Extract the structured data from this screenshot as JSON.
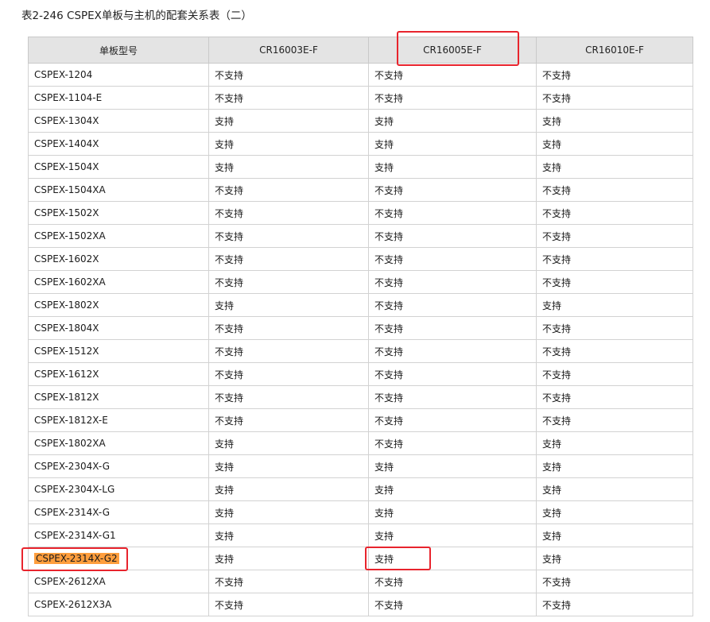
{
  "table": {
    "caption": "表2-246 CSPEX单板与主机的配套关系表（二）",
    "headers": [
      "单板型号",
      "CR16003E-F",
      "CR16005E-F",
      "CR16010E-F"
    ],
    "rows": [
      [
        "CSPEX-1204",
        "不支持",
        "不支持",
        "不支持"
      ],
      [
        "CSPEX-1104-E",
        "不支持",
        "不支持",
        "不支持"
      ],
      [
        "CSPEX-1304X",
        "支持",
        "支持",
        "支持"
      ],
      [
        "CSPEX-1404X",
        "支持",
        "支持",
        "支持"
      ],
      [
        "CSPEX-1504X",
        "支持",
        "支持",
        "支持"
      ],
      [
        "CSPEX-1504XA",
        "不支持",
        "不支持",
        "不支持"
      ],
      [
        "CSPEX-1502X",
        "不支持",
        "不支持",
        "不支持"
      ],
      [
        "CSPEX-1502XA",
        "不支持",
        "不支持",
        "不支持"
      ],
      [
        "CSPEX-1602X",
        "不支持",
        "不支持",
        "不支持"
      ],
      [
        "CSPEX-1602XA",
        "不支持",
        "不支持",
        "不支持"
      ],
      [
        "CSPEX-1802X",
        "支持",
        "不支持",
        "支持"
      ],
      [
        "CSPEX-1804X",
        "不支持",
        "不支持",
        "不支持"
      ],
      [
        "CSPEX-1512X",
        "不支持",
        "不支持",
        "不支持"
      ],
      [
        "CSPEX-1612X",
        "不支持",
        "不支持",
        "不支持"
      ],
      [
        "CSPEX-1812X",
        "不支持",
        "不支持",
        "不支持"
      ],
      [
        "CSPEX-1812X-E",
        "不支持",
        "不支持",
        "不支持"
      ],
      [
        "CSPEX-1802XA",
        "支持",
        "不支持",
        "支持"
      ],
      [
        "CSPEX-2304X-G",
        "支持",
        "支持",
        "支持"
      ],
      [
        "CSPEX-2304X-LG",
        "支持",
        "支持",
        "支持"
      ],
      [
        "CSPEX-2314X-G",
        "支持",
        "支持",
        "支持"
      ],
      [
        "CSPEX-2314X-G1",
        "支持",
        "支持",
        "支持"
      ],
      [
        "CSPEX-2314X-G2",
        "支持",
        "支持",
        "支持"
      ],
      [
        "CSPEX-2612XA",
        "不支持",
        "不支持",
        "不支持"
      ],
      [
        "CSPEX-2612X3A",
        "不支持",
        "不支持",
        "不支持"
      ]
    ]
  },
  "colors": {
    "highlight": "#ff9e3d",
    "annotation_box": "#e8242d",
    "header_bg": "#e4e4e4"
  }
}
